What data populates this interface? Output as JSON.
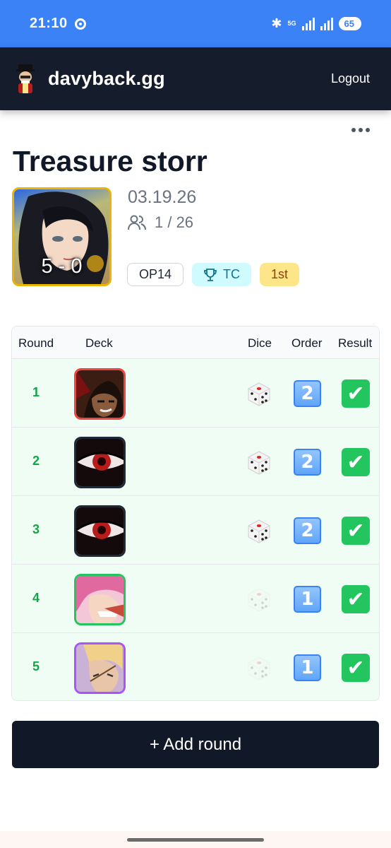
{
  "status": {
    "time": "21:10",
    "network": "5G",
    "battery": "65"
  },
  "header": {
    "brand": "davyback.gg",
    "logout": "Logout"
  },
  "event": {
    "title": "Treasure storr",
    "date": "03.19.26",
    "players": "1 / 26",
    "score": "5 - 0",
    "badges": {
      "set": "OP14",
      "type": "TC",
      "placement": "1st"
    }
  },
  "table": {
    "headers": {
      "round": "Round",
      "deck": "Deck",
      "dice": "Dice",
      "order": "Order",
      "result": "Result"
    },
    "rows": [
      {
        "round": "1",
        "dice": "rolled",
        "order": "2",
        "result": "win",
        "deck_border": "#ef4444"
      },
      {
        "round": "2",
        "dice": "rolled",
        "order": "2",
        "result": "win",
        "deck_border": "#1f2937"
      },
      {
        "round": "3",
        "dice": "rolled",
        "order": "2",
        "result": "win",
        "deck_border": "#1f2937"
      },
      {
        "round": "4",
        "dice": "faded",
        "order": "1",
        "result": "win",
        "deck_border": "#22c55e"
      },
      {
        "round": "5",
        "dice": "faded",
        "order": "1",
        "result": "win",
        "deck_border": "#a855f7"
      }
    ]
  },
  "actions": {
    "add_round": "+ Add round"
  },
  "colors": {
    "accent": "#3b82f6",
    "header_bg": "#151c2c",
    "win_row": "#f0fdf4",
    "round_text": "#16a34a"
  }
}
